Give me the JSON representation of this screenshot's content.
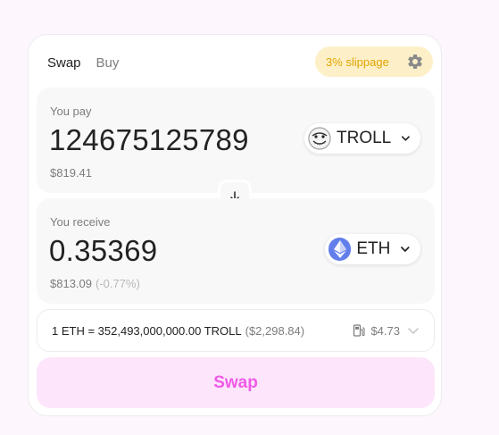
{
  "tabs": {
    "swap": "Swap",
    "buy": "Buy"
  },
  "slippage": {
    "label": "3% slippage",
    "icon": "gear-icon"
  },
  "pay": {
    "label": "You pay",
    "amount": "124675125789",
    "usd": "$819.41",
    "token": {
      "symbol": "TROLL",
      "icon": "troll-token-icon"
    }
  },
  "switch_icon": "arrow-down-icon",
  "receive": {
    "label": "You receive",
    "amount": "0.35369",
    "usd": "$813.09",
    "diff": "(-0.77%)",
    "token": {
      "symbol": "ETH",
      "icon": "eth-token-icon"
    }
  },
  "rate": {
    "text": "1 ETH = 352,493,000,000.00 TROLL",
    "usd": "($2,298.84)",
    "gas": "$4.73",
    "gas_icon": "gas-pump-icon"
  },
  "action": {
    "label": "Swap"
  },
  "colors": {
    "accent": "#f05ae8",
    "accent_bg": "#fde6fb",
    "slippage_text": "#e2a400",
    "slippage_bg": "#fdf0c8",
    "eth": "#627eea"
  }
}
